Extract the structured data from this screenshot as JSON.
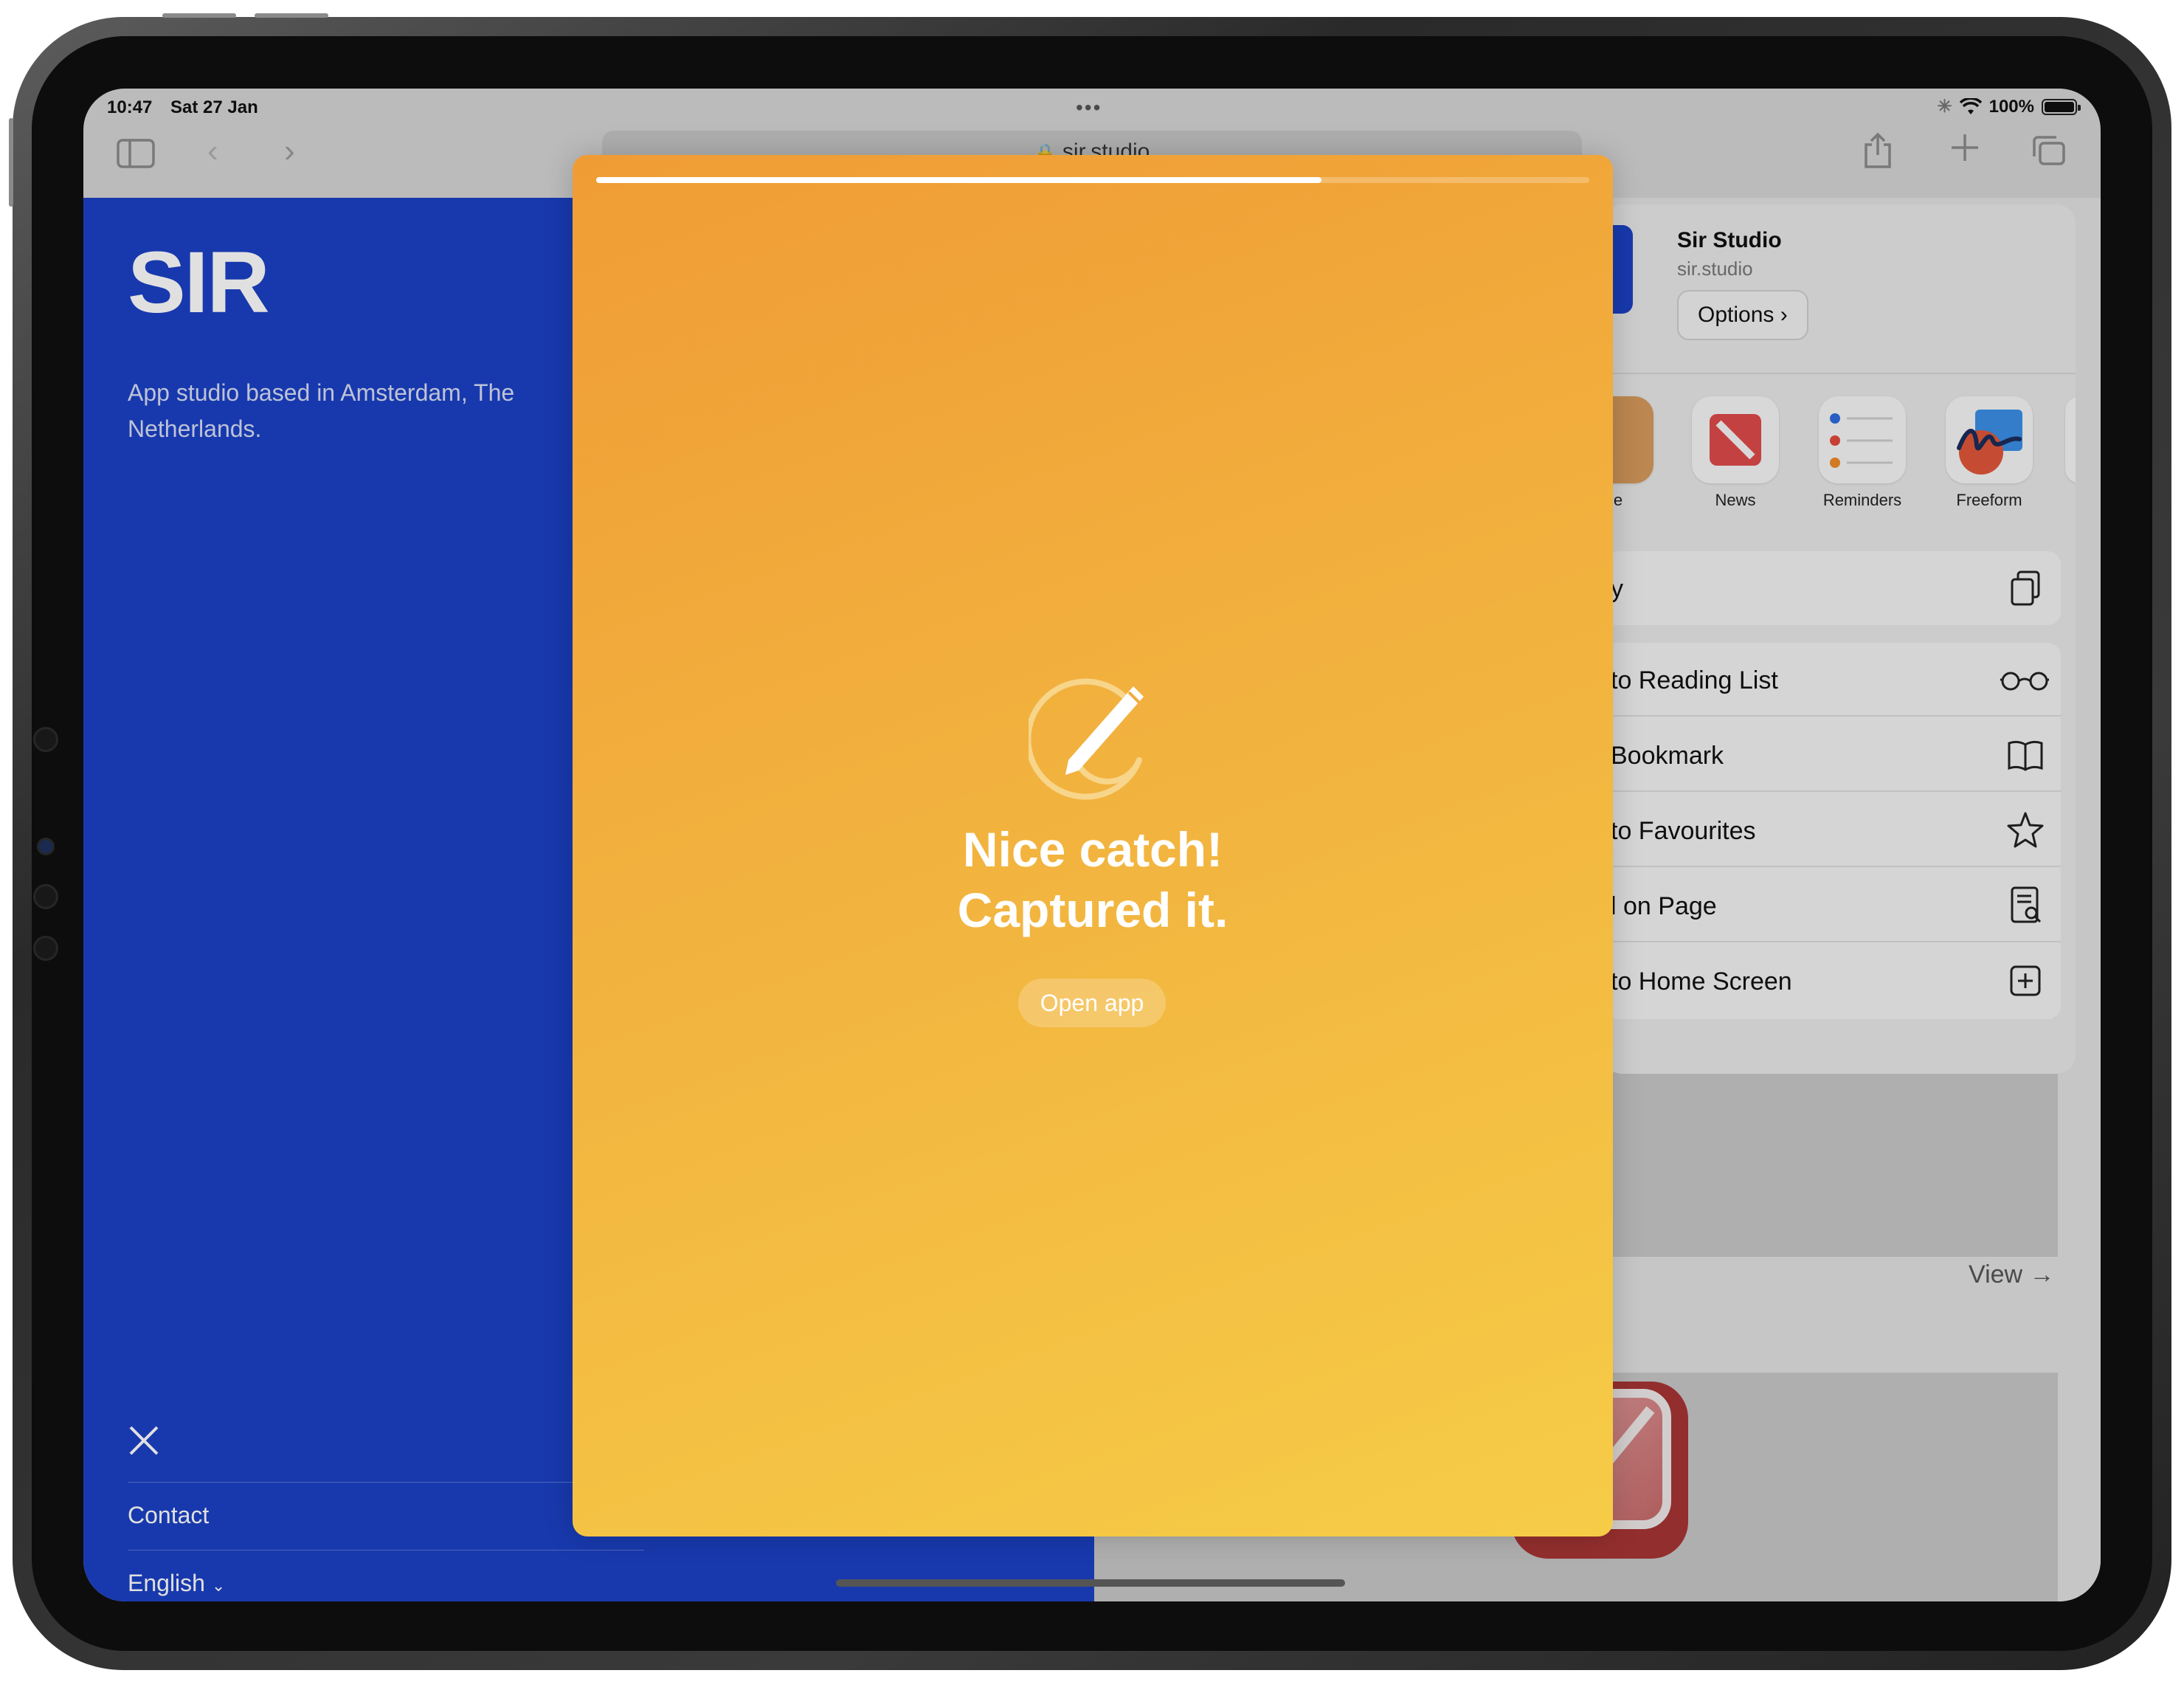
{
  "status_bar": {
    "time": "10:47",
    "date": "Sat 27 Jan",
    "battery": "100%"
  },
  "browser": {
    "url": "sir.studio"
  },
  "site": {
    "logo": "SIR",
    "tagline": "App studio based in Amsterdam, The Netherlands.",
    "social_icon": "x-logo-icon",
    "contact": "Contact",
    "language": "English",
    "view_link": "View →",
    "brand_color": "#1c41c5"
  },
  "share_sheet": {
    "title": "Sir Studio",
    "subtitle": "sir.studio",
    "options": "Options",
    "apps": [
      {
        "label": "e",
        "icon": "partial-app-icon"
      },
      {
        "label": "News",
        "icon": "news-icon"
      },
      {
        "label": "Reminders",
        "icon": "reminders-icon"
      },
      {
        "label": "Freeform",
        "icon": "freeform-icon"
      }
    ],
    "copy_label": "y",
    "actions": [
      {
        "label": "to Reading List",
        "icon": "glasses-icon"
      },
      {
        "label": "Bookmark",
        "icon": "book-icon"
      },
      {
        "label": "to Favourites",
        "icon": "star-icon"
      },
      {
        "label": "l on Page",
        "icon": "find-in-page-icon"
      },
      {
        "label": "to Home Screen",
        "icon": "add-square-icon"
      }
    ]
  },
  "capture": {
    "headline_line1": "Nice catch!",
    "headline_line2": "Captured it.",
    "button": "Open app",
    "progress": 0.73,
    "gradient_start": "#f09c35",
    "gradient_end": "#f6cc47"
  }
}
